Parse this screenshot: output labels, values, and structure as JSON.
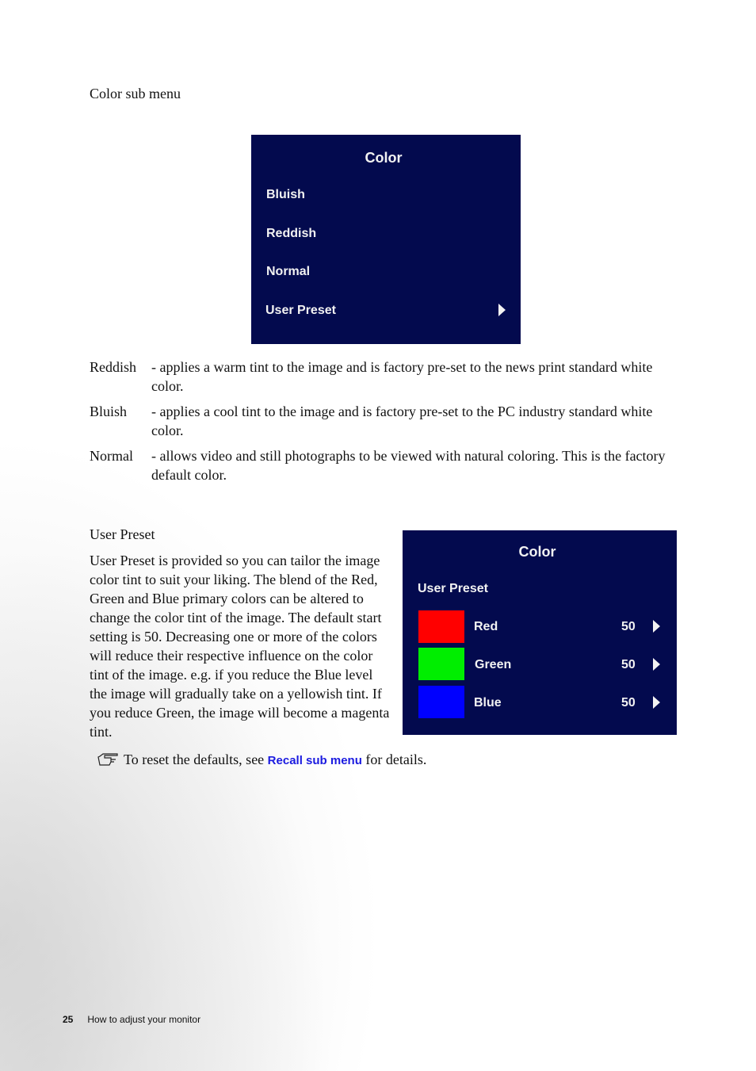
{
  "section1": {
    "heading": "Color sub menu",
    "osd": {
      "title": "Color",
      "items": [
        {
          "label": "Bluish"
        },
        {
          "label": "Reddish"
        },
        {
          "label": "Normal"
        },
        {
          "label": "User Preset",
          "icon": "triangle-right-icon"
        }
      ],
      "background": "#030a4e"
    },
    "descriptions": [
      {
        "term": "Reddish",
        "text": "- applies a warm tint to the image and is factory pre-set to the news print standard white color."
      },
      {
        "term": "Bluish",
        "text": "- applies a cool tint to the image and is factory pre-set to the PC industry standard white color."
      },
      {
        "term": "Normal",
        "text": "- allows video and still photographs to be viewed with natural coloring. This is the factory default color."
      }
    ]
  },
  "section2": {
    "heading": "User Preset",
    "paragraph": "User Preset is provided so you can tailor the image color tint to suit your liking. The blend of the Red, Green and Blue primary colors can be altered to change the color tint of the image. The default start setting is 50. Decreasing one or more of the colors will reduce their respective influence on the color tint of the image. e.g. if you reduce the Blue level the image will gradually take on a yellowish tint. If you reduce Green, the image will become a magenta tint.",
    "osd": {
      "title": "Color",
      "subtitle": "User Preset",
      "channels": [
        {
          "label": "Red",
          "value": "50",
          "swatch": "#ff0000"
        },
        {
          "label": "Green",
          "value": "50",
          "swatch": "#00ee00"
        },
        {
          "label": "Blue",
          "value": "50",
          "swatch": "#0000ff"
        }
      ]
    },
    "note": {
      "icon": "pointing-hand-icon",
      "prefix": "To reset the defaults, see ",
      "link": "Recall sub menu",
      "suffix": " for details."
    }
  },
  "footer": {
    "page_number": "25",
    "chapter": "How to adjust your monitor"
  }
}
